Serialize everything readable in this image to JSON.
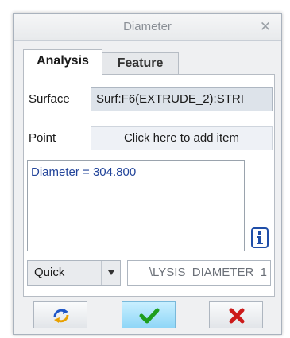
{
  "window": {
    "title": "Diameter"
  },
  "tabs": [
    {
      "label": "Analysis",
      "active": true
    },
    {
      "label": "Feature",
      "active": false
    }
  ],
  "surface": {
    "label": "Surface",
    "value": "Surf:F6(EXTRUDE_2):STRI"
  },
  "point": {
    "label": "Point",
    "value": "Click here to add item"
  },
  "result": {
    "text": "Diameter = 304.800"
  },
  "mode_select": {
    "selected": "Quick"
  },
  "analysis_name": {
    "value": "\\LYSIS_DIAMETER_1"
  },
  "icons": {
    "close": "close-icon",
    "info": "info-icon",
    "dropdown": "chevron-down-icon",
    "repeat": "repeat-icon",
    "ok": "checkmark-icon",
    "cancel": "x-icon"
  },
  "colors": {
    "result_text": "#22449a",
    "info": "#1f4ea8",
    "ok_button": "#8fd6f7",
    "ok_check": "#1e9e1e",
    "cancel_x": "#cc1a1a"
  }
}
